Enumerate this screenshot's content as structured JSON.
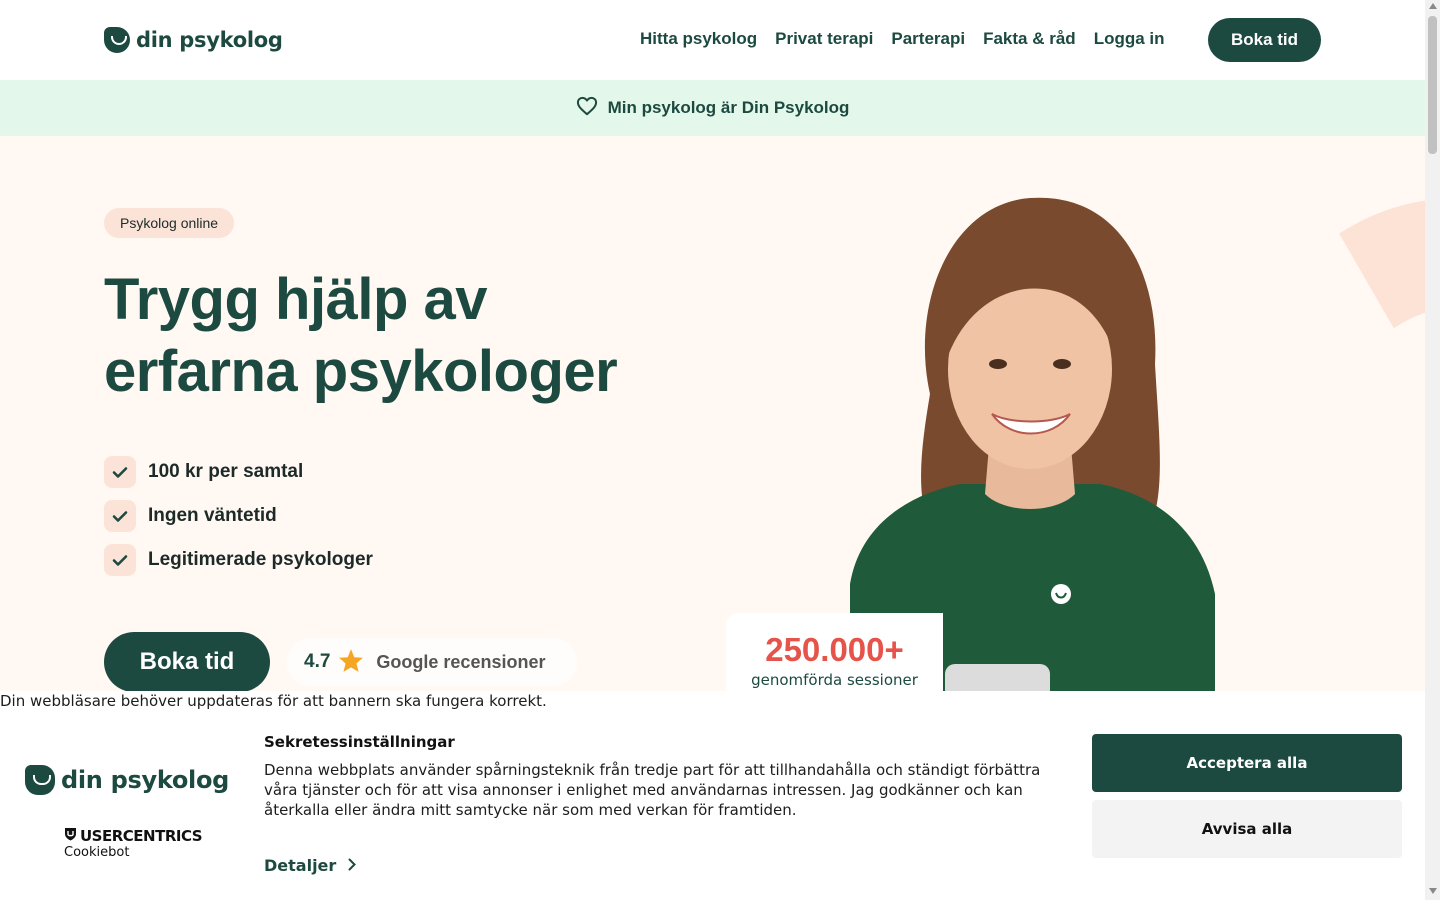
{
  "header": {
    "logo_text": "din psykolog",
    "nav": [
      "Hitta psykolog",
      "Privat terapi",
      "Parterapi",
      "Fakta & råd",
      "Logga in"
    ],
    "cta_label": "Boka tid"
  },
  "banner": {
    "icon": "heart-icon",
    "text": "Min psykolog är Din Psykolog"
  },
  "hero": {
    "badge": "Psykolog online",
    "headline": "Trygg hjälp av erfarna psykologer",
    "features": [
      "100 kr per samtal",
      "Ingen väntetid",
      "Legitimerade psykologer"
    ],
    "cta_label": "Boka tid",
    "rating": {
      "score": "4.7",
      "label": "Google recensioner"
    },
    "stats": {
      "number": "250.000+",
      "label": "genomförda sessioner"
    }
  },
  "cookie": {
    "warning": "Din webbläsare behöver uppdateras för att bannern ska fungera korrekt.",
    "logo_text": "din psykolog",
    "provider_name": "USERCENTRICS",
    "provider_sub": "Cookiebot",
    "title": "Sekretessinställningar",
    "body": "Denna webbplats använder spårningsteknik från tredje part för att tillhandahålla och ständigt förbättra våra tjänster och för att visa annonser i enlighet med användarnas intressen. Jag godkänner och kan återkalla eller ändra mitt samtycke när som med verkan för framtiden.",
    "details_label": "Detaljer",
    "accept_label": "Acceptera alla",
    "reject_label": "Avvisa alla"
  },
  "colors": {
    "brand_green": "#1d4a40",
    "banner_bg": "#e3f7ea",
    "hero_bg": "#fff8f3",
    "accent_peach": "#fbe3d8",
    "stat_red": "#e6534a",
    "star": "#f5a623"
  }
}
